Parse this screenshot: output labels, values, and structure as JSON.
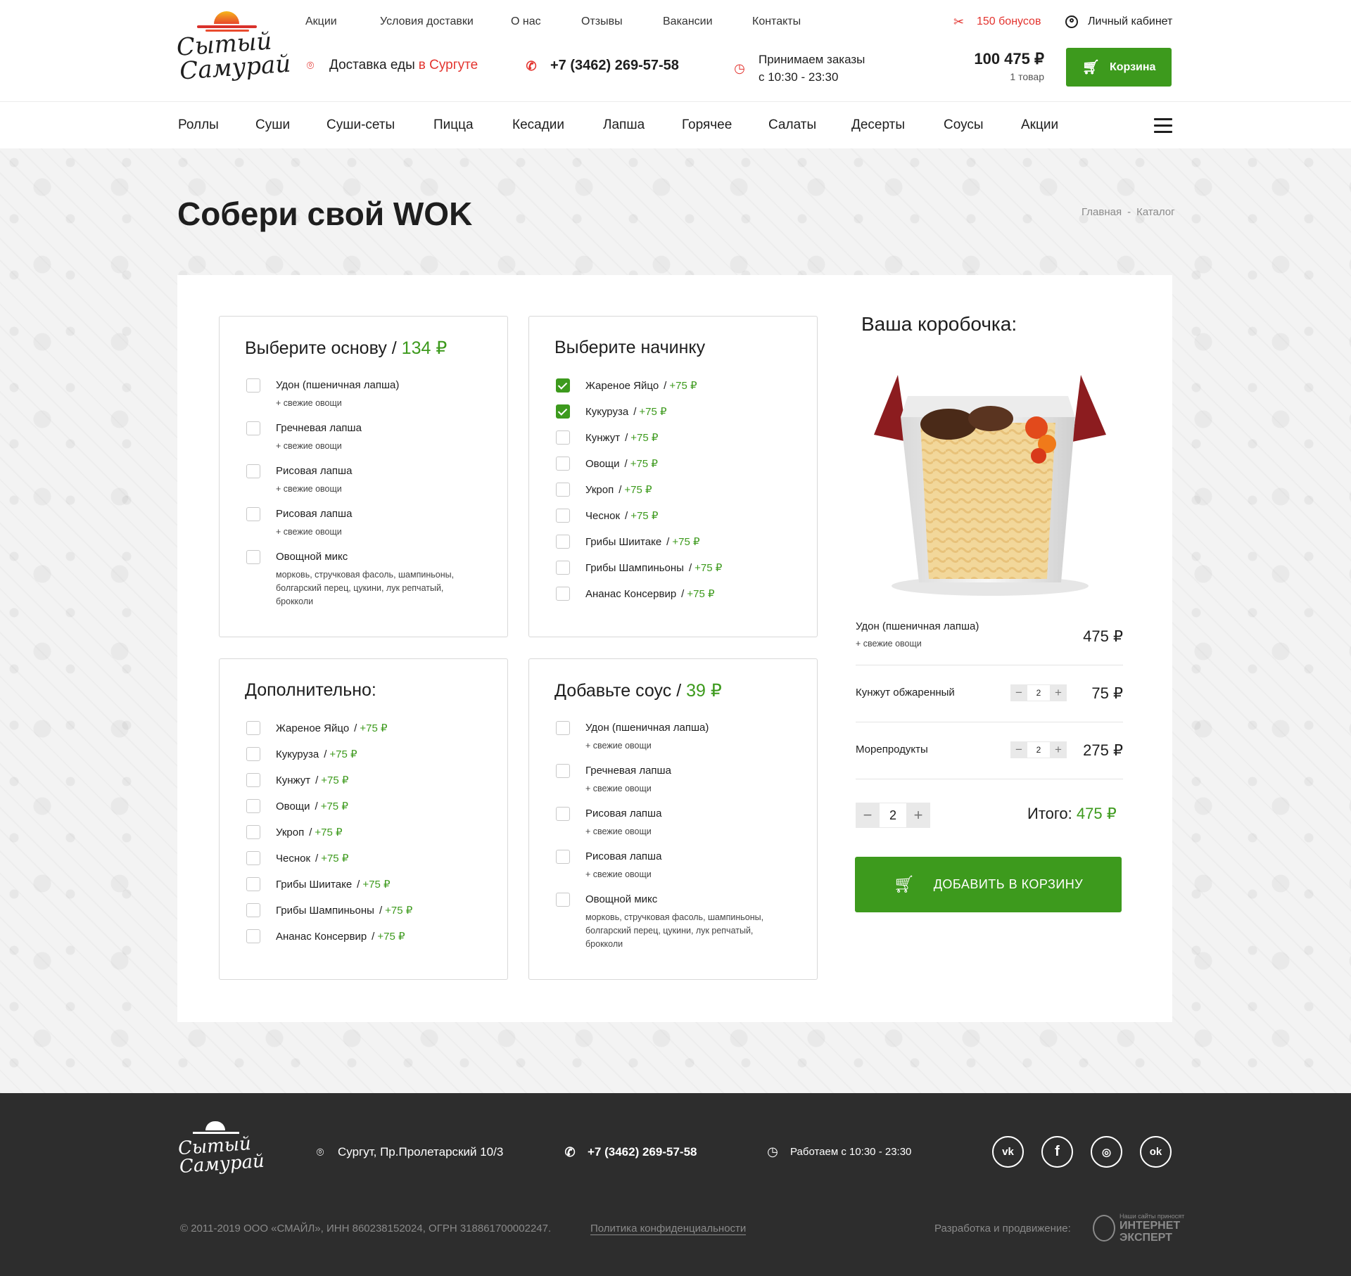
{
  "brand": {
    "line1": "Сытый",
    "line2": "Самурай"
  },
  "topnav": [
    "Акции",
    "Условия доставки",
    "О нас",
    "Отзывы",
    "Вакансии",
    "Контакты"
  ],
  "bonus": "150 бонусов",
  "cabinet": "Личный кабинет",
  "delivery": {
    "label": "Доставка еды",
    "city": "в Сургуте"
  },
  "phone": "+7 (3462) 269-57-58",
  "hours": {
    "line1": "Принимаем заказы",
    "line2": "с 10:30 - 23:30"
  },
  "cart": {
    "sum": "100 475 ₽",
    "items": "1 товар",
    "button": "Корзина"
  },
  "categories": [
    "Роллы",
    "Суши",
    "Суши-сеты",
    "Пицца",
    "Кесадии",
    "Лапша",
    "Горячее",
    "Салаты",
    "Десерты",
    "Соусы",
    "Акции"
  ],
  "page_title": "Собери свой WOK",
  "breadcrumb": [
    "Главная",
    "-",
    "Каталог"
  ],
  "base_panel": {
    "title": "Выберите основу /",
    "price": "134 ₽",
    "options": [
      {
        "name": "Удон (пшеничная лапша)",
        "sub": "+ свежие овощи",
        "checked": false
      },
      {
        "name": "Гречневая лапша",
        "sub": "+ свежие овощи",
        "checked": false
      },
      {
        "name": "Рисовая лапша",
        "sub": "+ свежие овощи",
        "checked": false
      },
      {
        "name": "Рисовая лапша",
        "sub": "+ свежие овощи",
        "checked": false
      },
      {
        "name": "Овощной микс",
        "sub": "морковь, стручковая фасоль, шампиньоны, болгарский перец, цукини, лук репчатый, брокколи",
        "checked": false
      }
    ]
  },
  "filling_panel": {
    "title": "Выберите начинку",
    "options": [
      {
        "name": "Жареное Яйцо",
        "add": "+75 ₽",
        "checked": true
      },
      {
        "name": "Кукуруза",
        "add": "+75 ₽",
        "checked": true
      },
      {
        "name": "Кунжут",
        "add": "+75 ₽",
        "checked": false
      },
      {
        "name": "Овощи",
        "add": "+75 ₽",
        "checked": false
      },
      {
        "name": "Укроп",
        "add": "+75 ₽",
        "checked": false
      },
      {
        "name": "Чеснок",
        "add": "+75 ₽",
        "checked": false
      },
      {
        "name": "Грибы Шиитаке",
        "add": "+75 ₽",
        "checked": false
      },
      {
        "name": "Грибы Шампиньоны",
        "add": "+75 ₽",
        "checked": false
      },
      {
        "name": "Ананас Консервир",
        "add": "+75 ₽",
        "checked": false
      }
    ]
  },
  "extra_panel": {
    "title": "Дополнительно:",
    "options": [
      {
        "name": "Жареное Яйцо",
        "add": "+75 ₽",
        "checked": false
      },
      {
        "name": "Кукуруза",
        "add": "+75 ₽",
        "checked": false
      },
      {
        "name": "Кунжут",
        "add": "+75 ₽",
        "checked": false
      },
      {
        "name": "Овощи",
        "add": "+75 ₽",
        "checked": false
      },
      {
        "name": "Укроп",
        "add": "+75 ₽",
        "checked": false
      },
      {
        "name": "Чеснок",
        "add": "+75 ₽",
        "checked": false
      },
      {
        "name": "Грибы Шиитаке",
        "add": "+75 ₽",
        "checked": false
      },
      {
        "name": "Грибы Шампиньоны",
        "add": "+75 ₽",
        "checked": false
      },
      {
        "name": "Ананас Консервир",
        "add": "+75 ₽",
        "checked": false
      }
    ]
  },
  "sauce_panel": {
    "title": "Добавьте соус /",
    "price": "39 ₽",
    "options": [
      {
        "name": "Удон (пшеничная лапша)",
        "sub": "+ свежие овощи",
        "checked": false
      },
      {
        "name": "Гречневая лапша",
        "sub": "+ свежие овощи",
        "checked": false
      },
      {
        "name": "Рисовая лапша",
        "sub": "+ свежие овощи",
        "checked": false
      },
      {
        "name": "Рисовая лапша",
        "sub": "+ свежие овощи",
        "checked": false
      },
      {
        "name": "Овощной микс",
        "sub": "морковь, стручковая фасоль, шампиньоны, болгарский перец, цукини, лук репчатый, брокколи",
        "checked": false
      }
    ]
  },
  "box": {
    "title": "Ваша коробочка:",
    "rows": [
      {
        "name": "Удон (пшеничная лапша)",
        "sub": "+ свежие овощи",
        "price": "475 ₽"
      },
      {
        "name": "Кунжут обжаренный",
        "qty": "2",
        "price": "75 ₽"
      },
      {
        "name": "Морепродукты",
        "qty": "2",
        "price": "275 ₽"
      }
    ],
    "qty": "2",
    "total_label": "Итого:",
    "total": "475 ₽",
    "add_button": "ДОБАВИТЬ В КОРЗИНУ"
  },
  "footer": {
    "address": "Сургут, Пр.Пролетарский 10/3",
    "phone": "+7 (3462) 269-57-58",
    "hours": "Работаем с 10:30 - 23:30",
    "socials": [
      "vk",
      "f",
      "ig",
      "ok"
    ],
    "copyright": "© 2011-2019   ООО «СМАЙЛ», ИНН 860238152024, ОГРН 318861700002247.",
    "privacy": "Политика конфиденциальности",
    "dev_label": "Разработка и продвижение:",
    "dev_small": "Наши сайты приносят",
    "dev_name1": "ИНТЕРНЕТ",
    "dev_name2": "ЭКСПЕРТ"
  },
  "colors": {
    "accent": "#3d9a1d",
    "red": "#e3342f",
    "footer": "#2d2d2d"
  }
}
